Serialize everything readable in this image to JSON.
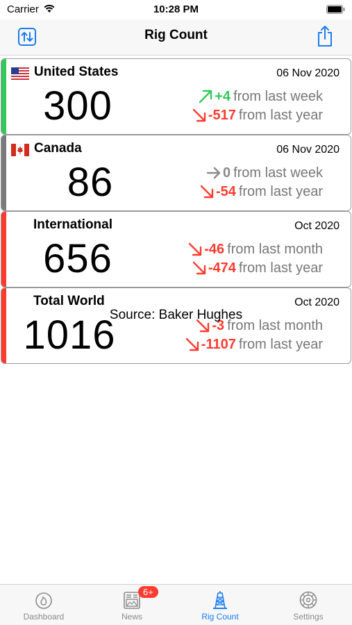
{
  "status": {
    "carrier": "Carrier",
    "time": "10:28 PM"
  },
  "nav": {
    "title": "Rig Count"
  },
  "cards": [
    {
      "name": "United States",
      "date": "06 Nov 2020",
      "count": "300",
      "accent": "#34c759",
      "changes": [
        {
          "value": "+4",
          "text": "from last week",
          "direction": "up",
          "color": "#34c759"
        },
        {
          "value": "-517",
          "text": "from last year",
          "direction": "down",
          "color": "#ff3b30"
        }
      ]
    },
    {
      "name": "Canada",
      "date": "06 Nov 2020",
      "count": "86",
      "accent": "#7a7a7a",
      "changes": [
        {
          "value": "0",
          "text": "from last week",
          "direction": "flat",
          "color": "#8a8a8a"
        },
        {
          "value": "-54",
          "text": "from last year",
          "direction": "down",
          "color": "#ff3b30"
        }
      ]
    },
    {
      "name": "International",
      "date": "Oct 2020",
      "count": "656",
      "accent": "#ff3b30",
      "changes": [
        {
          "value": "-46",
          "text": "from last month",
          "direction": "down",
          "color": "#ff3b30"
        },
        {
          "value": "-474",
          "text": "from last year",
          "direction": "down",
          "color": "#ff3b30"
        }
      ]
    },
    {
      "name": "Total World",
      "date": "Oct 2020",
      "count": "1016",
      "accent": "#ff3b30",
      "changes": [
        {
          "value": "-3",
          "text": "from last month",
          "direction": "down",
          "color": "#ff3b30"
        },
        {
          "value": "-1107",
          "text": "from last year",
          "direction": "down",
          "color": "#ff3b30"
        }
      ]
    }
  ],
  "source": "Source: Baker Hughes",
  "tabs": [
    {
      "label": "Dashboard",
      "icon": "flame-icon"
    },
    {
      "label": "News",
      "icon": "newspaper-icon",
      "badge": "6+"
    },
    {
      "label": "Rig Count",
      "icon": "oil-rig-icon",
      "active": true
    },
    {
      "label": "Settings",
      "icon": "gear-icon"
    }
  ],
  "colors": {
    "accent_blue": "#1a7cf2",
    "up": "#34c759",
    "down": "#ff3b30",
    "neutral": "#8a8a8a"
  }
}
